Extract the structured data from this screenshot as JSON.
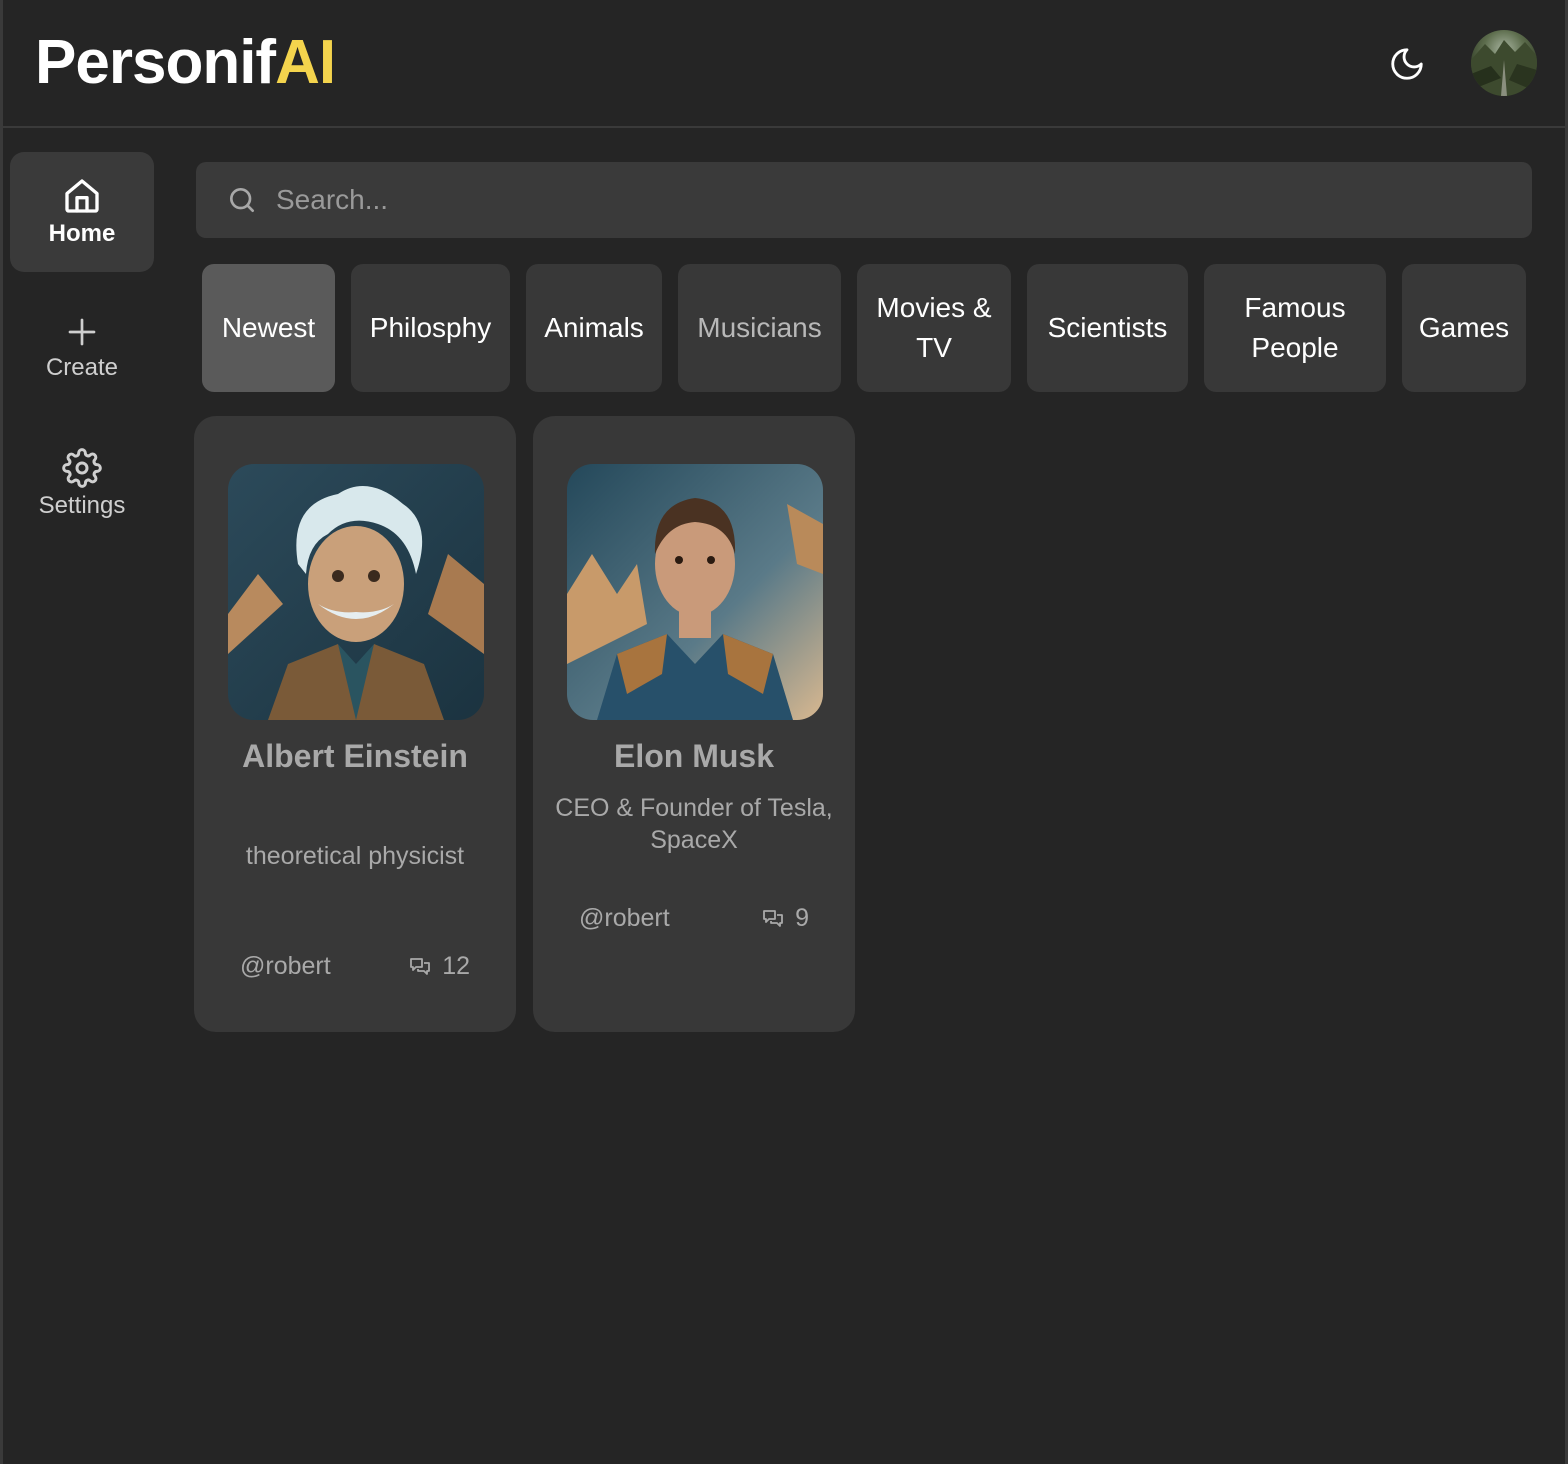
{
  "header": {
    "logo_main": "Personif",
    "logo_accent": "AI",
    "theme_toggle_icon": "moon-icon",
    "avatar_icon": "user-avatar"
  },
  "sidebar": {
    "items": [
      {
        "label": "Home",
        "icon": "home-icon",
        "active": true
      },
      {
        "label": "Create",
        "icon": "plus-icon",
        "active": false
      },
      {
        "label": "Settings",
        "icon": "gear-icon",
        "active": false
      }
    ]
  },
  "search": {
    "placeholder": "Search...",
    "icon": "search-icon"
  },
  "categories": [
    {
      "label": "Newest",
      "active": true
    },
    {
      "label": "Philosphy"
    },
    {
      "label": "Animals"
    },
    {
      "label": "Musicians"
    },
    {
      "label": "Movies & TV"
    },
    {
      "label": "Scientists"
    },
    {
      "label": "Famous People"
    },
    {
      "label": "Games"
    }
  ],
  "companions": [
    {
      "name": "Albert Einstein",
      "description": "theoretical physicist",
      "author": "@robert",
      "messages": "12"
    },
    {
      "name": "Elon Musk",
      "description": "CEO & Founder of Tesla, SpaceX",
      "author": "@robert",
      "messages": "9"
    }
  ],
  "colors": {
    "background": "#252525",
    "surface": "#383838",
    "accent": "#f4d44d",
    "active_category": "#5a5a5a"
  }
}
